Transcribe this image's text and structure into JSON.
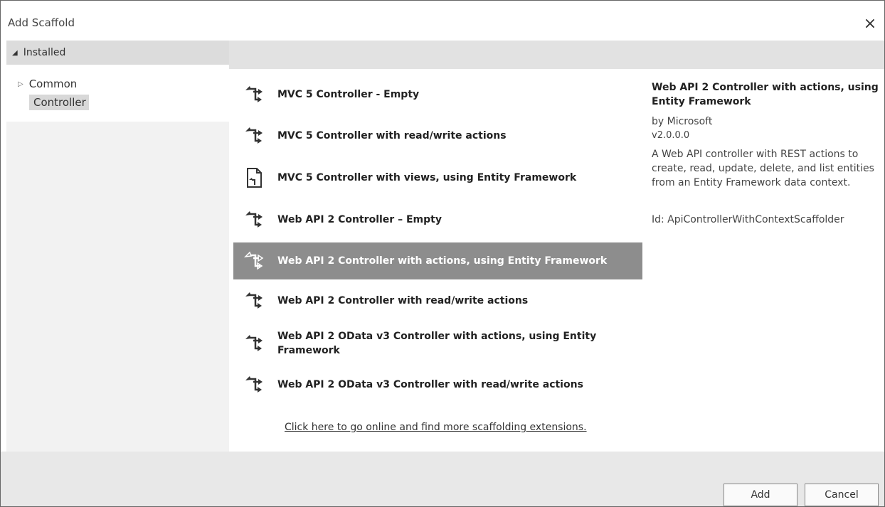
{
  "window": {
    "title": "Add Scaffold",
    "close_label": "×"
  },
  "sidebar": {
    "installed_label": "Installed",
    "tree": [
      {
        "label": "Common"
      },
      {
        "label": "Controller"
      }
    ]
  },
  "scaffolds": [
    {
      "label": "MVC 5 Controller - Empty",
      "icon": "controller-icon"
    },
    {
      "label": "MVC 5 Controller with read/write actions",
      "icon": "controller-icon"
    },
    {
      "label": "MVC 5 Controller with views, using Entity Framework",
      "icon": "document-icon"
    },
    {
      "label": "Web API 2 Controller – Empty",
      "icon": "controller-icon"
    },
    {
      "label": "Web API 2 Controller with actions, using Entity Framework",
      "icon": "controller-icon",
      "selected": true
    },
    {
      "label": "Web API 2 Controller with read/write actions",
      "icon": "controller-icon"
    },
    {
      "label": "Web API 2 OData v3 Controller with actions, using Entity Framework",
      "icon": "controller-icon"
    },
    {
      "label": "Web API 2 OData v3 Controller with read/write actions",
      "icon": "controller-icon"
    }
  ],
  "online_link": "Click here to go online and find more scaffolding extensions.",
  "details": {
    "title": "Web API 2 Controller with actions, using Entity Framework",
    "by": "by Microsoft",
    "version": "v2.0.0.0",
    "description": "A Web API controller with REST actions to create, read, update, delete, and list entities from an Entity Framework data context.",
    "id": "Id: ApiControllerWithContextScaffolder"
  },
  "buttons": {
    "add": "Add",
    "cancel": "Cancel"
  },
  "colors": {
    "selected_bg": "#8d8d8d",
    "header_bg": "#dcdcdc"
  }
}
